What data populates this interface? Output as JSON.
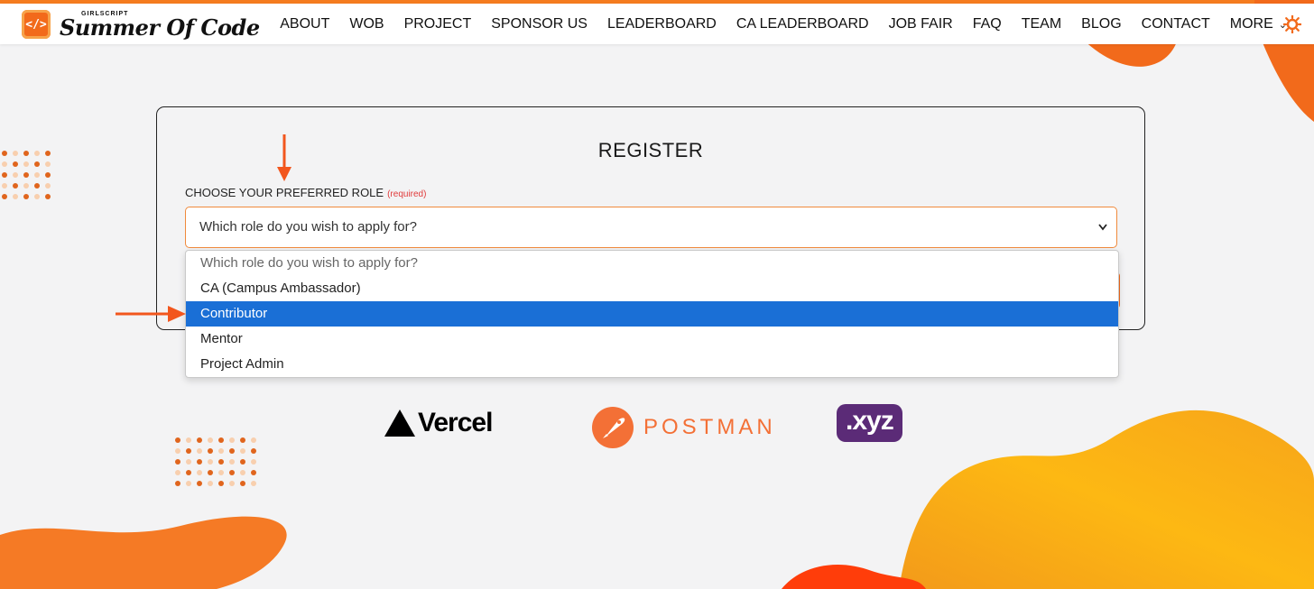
{
  "brand": {
    "badge": "</>",
    "small": "GIRLSCRIPT",
    "name": "Summer Of Code"
  },
  "nav": {
    "items": [
      "ABOUT",
      "WOB",
      "PROJECT",
      "SPONSOR US",
      "LEADERBOARD",
      "CA LEADERBOARD",
      "JOB FAIR",
      "FAQ",
      "TEAM",
      "BLOG",
      "CONTACT",
      "MORE"
    ],
    "more_icon": "chevron-down-icon",
    "theme_icon": "sun-icon"
  },
  "register": {
    "title": "REGISTER",
    "role_label": "CHOOSE YOUR PREFERRED ROLE",
    "required": "(required)",
    "select_value": "Which role do you wish to apply for?",
    "options": [
      "Which role do you wish to apply for?",
      "CA (Campus Ambassador)",
      "Contributor",
      "Mentor",
      "Project Admin"
    ],
    "selected_option": "Contributor"
  },
  "sponsors": {
    "vercel": "Vercel",
    "postman": "POSTMAN",
    "xyz": ".xyz"
  },
  "colors": {
    "accent": "#f26a1b",
    "selected_option_bg": "#1a6fd6",
    "required": "#e03a3a",
    "xyz_purple": "#5b2b77",
    "blob_yellow": "#fdb813"
  }
}
